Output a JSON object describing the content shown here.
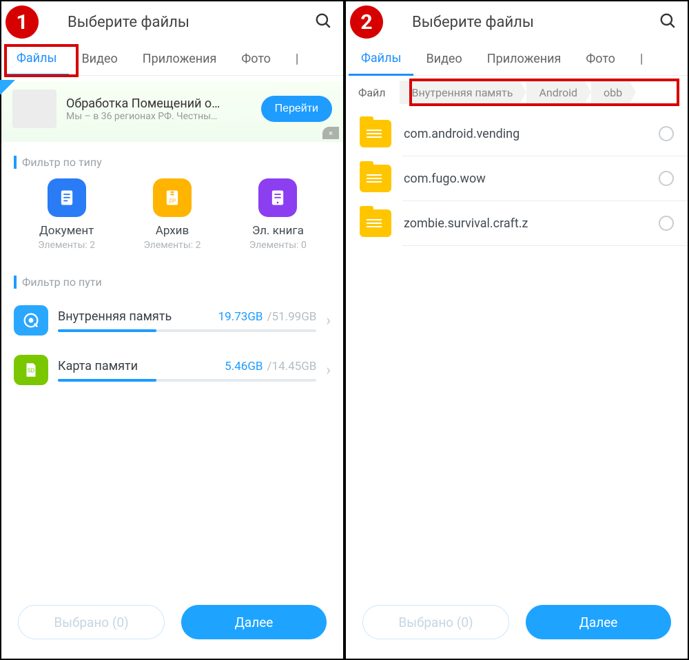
{
  "left": {
    "step": "1",
    "title": "Выберите файлы",
    "tabs": [
      "Файлы",
      "Видео",
      "Приложения",
      "Фото"
    ],
    "tab_overflow": "|",
    "ad": {
      "title": "Обработка Помещений о…",
      "subtitle": "Мы – в 36 регионах РФ. Честны…",
      "button": "Перейти",
      "close": "×"
    },
    "section_type": "Фильтр по типу",
    "types": [
      {
        "label": "Документ",
        "count": "Элементы: 2"
      },
      {
        "label": "Архив",
        "count": "Элементы: 2"
      },
      {
        "label": "Эл. книга",
        "count": "Элементы: 0"
      }
    ],
    "section_path": "Фильтр по пути",
    "storage": [
      {
        "name": "Внутренняя память",
        "used": "19.73GB",
        "total": "/51.99GB",
        "pct": 38
      },
      {
        "name": "Карта памяти",
        "used": "5.46GB",
        "total": "/14.45GB",
        "pct": 38
      }
    ],
    "selected": "Выбрано (0)",
    "next": "Далее"
  },
  "right": {
    "step": "2",
    "title": "Выберите файлы",
    "tabs": [
      "Файлы",
      "Видео",
      "Приложения",
      "Фото"
    ],
    "tab_overflow": "|",
    "breadcrumb": [
      "Файл",
      "Внутренняя память",
      "Android",
      "obb"
    ],
    "folders": [
      {
        "name": "com.android.vending"
      },
      {
        "name": "com.fugo.wow"
      },
      {
        "name": "zombie.survival.craft.z"
      }
    ],
    "selected": "Выбрано (0)",
    "next": "Далее"
  }
}
